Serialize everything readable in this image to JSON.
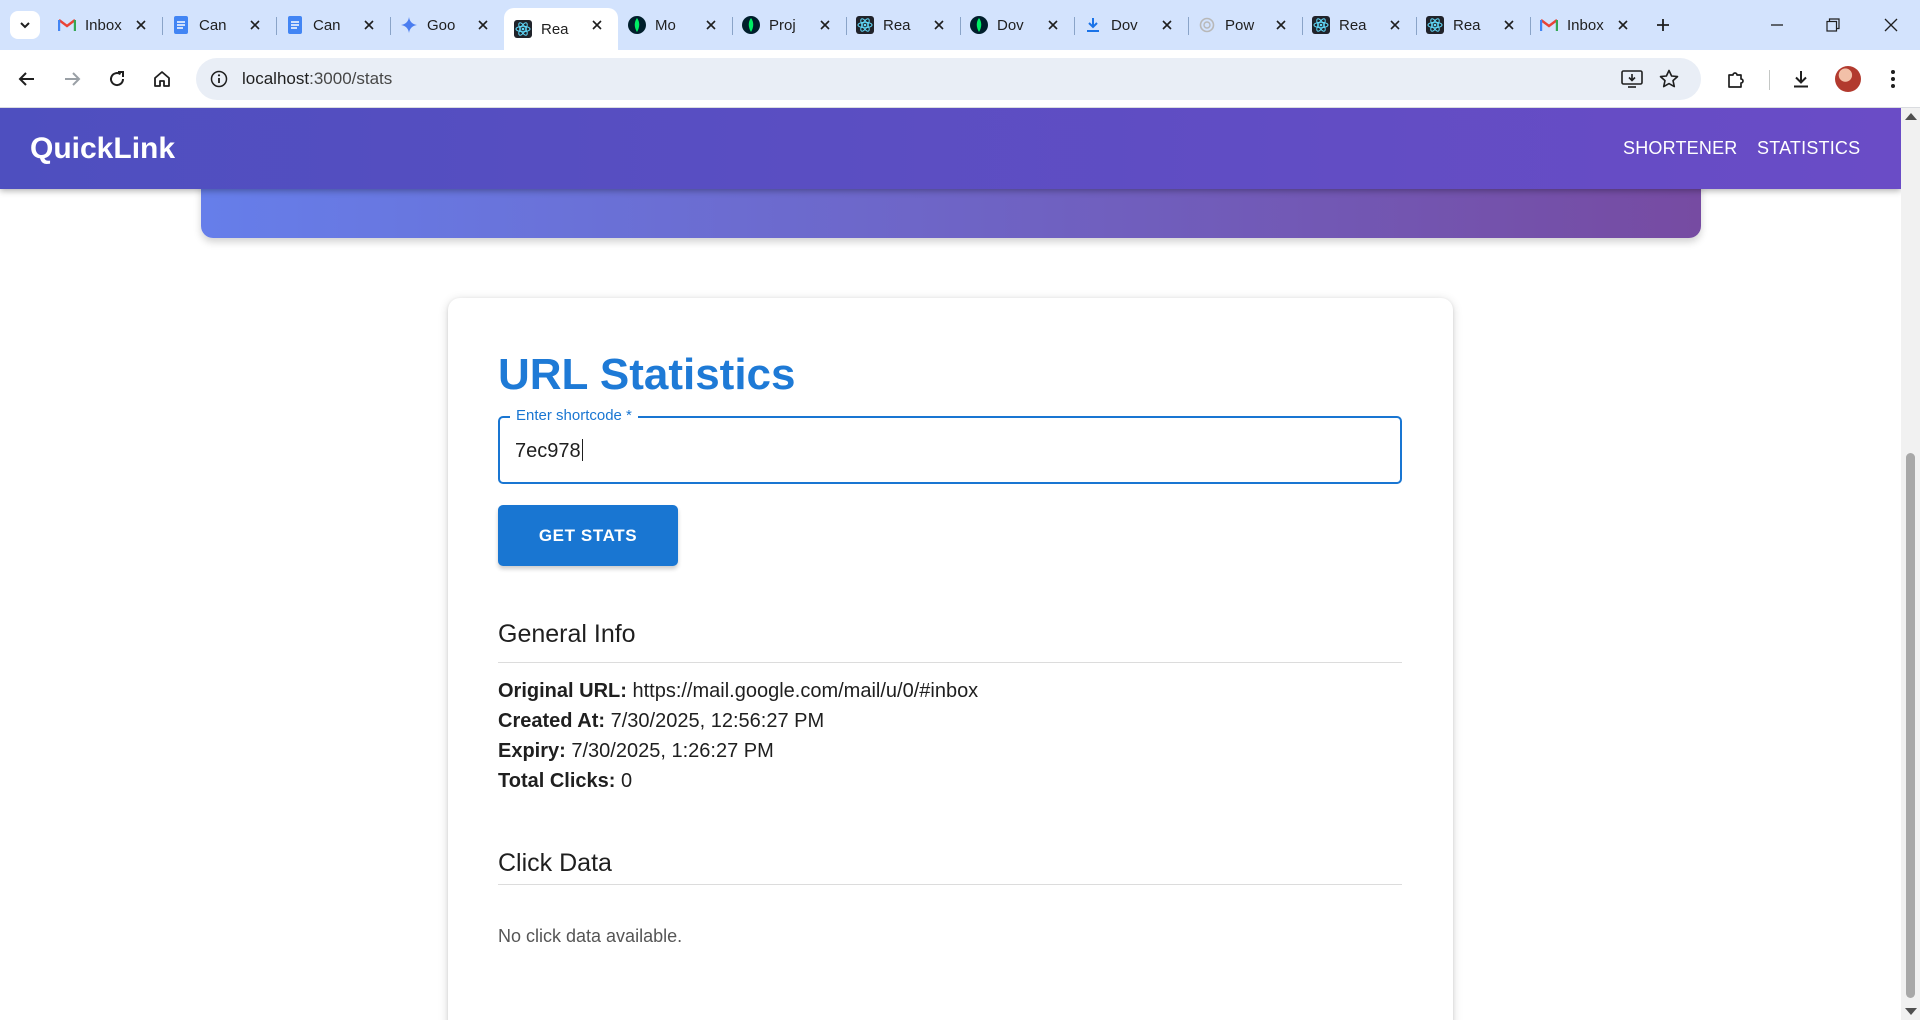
{
  "browser": {
    "tabs": [
      {
        "label": "Inbox",
        "icon": "gmail-icon",
        "active": false
      },
      {
        "label": "Can",
        "icon": "google-docs-icon",
        "active": false
      },
      {
        "label": "Can",
        "icon": "google-docs-icon",
        "active": false
      },
      {
        "label": "Goo",
        "icon": "gemini-icon",
        "active": false
      },
      {
        "label": "Rea",
        "icon": "react-icon",
        "active": true
      },
      {
        "label": "Mo",
        "icon": "mongodb-icon",
        "active": false
      },
      {
        "label": "Proj",
        "icon": "mongodb-icon",
        "active": false
      },
      {
        "label": "Rea",
        "icon": "react-icon",
        "active": false
      },
      {
        "label": "Dov",
        "icon": "mongodb-icon",
        "active": false
      },
      {
        "label": "Dov",
        "icon": "download-icon",
        "active": false
      },
      {
        "label": "Pow",
        "icon": "openai-icon",
        "active": false
      },
      {
        "label": "Rea",
        "icon": "react-icon",
        "active": false
      },
      {
        "label": "Rea",
        "icon": "react-icon",
        "active": false
      },
      {
        "label": "Inbox",
        "icon": "gmail-icon",
        "active": false
      }
    ],
    "address": {
      "host": "localhost",
      "path": ":3000/stats"
    }
  },
  "app": {
    "brand": "QuickLink",
    "nav": {
      "shortener": "SHORTENER",
      "statistics": "STATISTICS"
    }
  },
  "stats": {
    "title": "URL Statistics",
    "shortcode_label": "Enter shortcode *",
    "shortcode_value": "7ec978",
    "button_label": "GET STATS",
    "general_heading": "General Info",
    "info": {
      "original_url_label": "Original URL:",
      "original_url": "https://mail.google.com/mail/u/0/#inbox",
      "created_label": "Created At:",
      "created": "7/30/2025, 12:56:27 PM",
      "expiry_label": "Expiry:",
      "expiry": "7/30/2025, 1:26:27 PM",
      "clicks_label": "Total Clicks:",
      "clicks": "0"
    },
    "click_heading": "Click Data",
    "empty_message": "No click data available."
  },
  "colors": {
    "primary": "#1976d2",
    "title": "#1e7ad6",
    "appbar_start": "#4e4fbf",
    "appbar_end": "#6a4cc6"
  }
}
